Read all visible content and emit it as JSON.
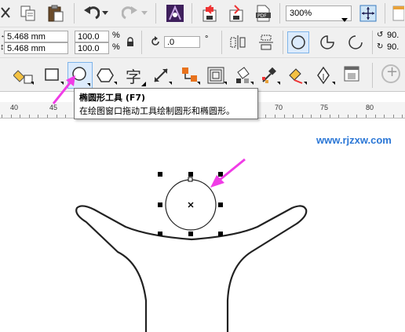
{
  "toolbar": {
    "zoom_value": "300%",
    "icons": [
      "cut-icon",
      "copy-icon",
      "paste-icon",
      "undo-icon",
      "redo-icon",
      "corel-connect-icon",
      "import-icon",
      "export-icon",
      "publish-pdf-icon",
      "zoom-dropdown",
      "full-screen-icon"
    ]
  },
  "property_bar": {
    "width_value": "5.468 mm",
    "height_value": "5.468 mm",
    "scale_x": "100.0",
    "scale_y": "100.0",
    "percent_symbol": "%",
    "rotation_value": ".0",
    "degree_symbol": "°",
    "right_value_1": "90.",
    "right_value_2": "90."
  },
  "toolbox": {
    "tools": [
      "smart-fill-tool",
      "rectangle-tool",
      "ellipse-tool",
      "polygon-tool",
      "text-tool",
      "parallel-dimension-tool",
      "connector-tool",
      "blend-tool",
      "fill-tool",
      "eyedropper-tool",
      "interactive-fill-tool",
      "outline-pen-tool",
      "drop-shadow-tool",
      "add-tool"
    ],
    "text_tool_glyph": "字",
    "add_glyph": "+"
  },
  "tooltip": {
    "title": "椭圆形工具 (F7)",
    "description": "在绘图窗口拖动工具绘制圆形和椭圆形。"
  },
  "ruler": {
    "labels": [
      "40",
      "45",
      "70",
      "75",
      "80"
    ]
  },
  "watermark": "www.rjzxw.com",
  "colors": {
    "arrow": "#f03ce6",
    "watermark": "#2b77d6",
    "toolbar_bg": "#f0f0f0"
  }
}
